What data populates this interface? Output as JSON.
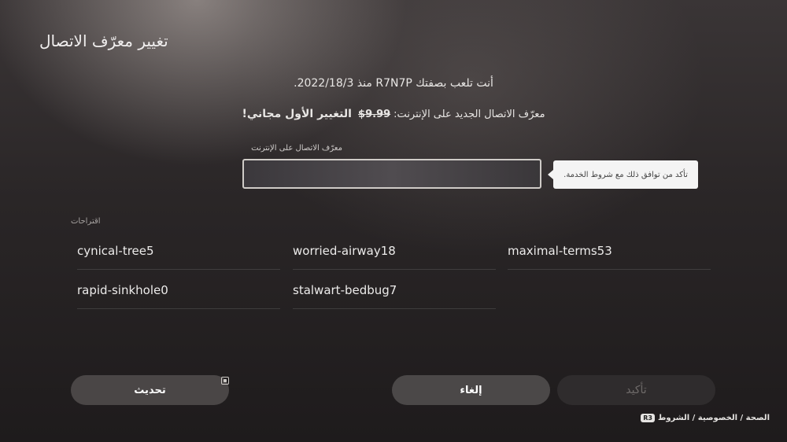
{
  "header": {
    "title": "تغيير معرّف الاتصال"
  },
  "info": {
    "line1": "أنت تلعب بصفتك R7N7P منذ 2022/18/3.",
    "line2_prefix": "معرّف الاتصال الجديد على الإنترنت:",
    "line2_price": "9.99$",
    "line2_free": "التغيير الأول مجاني!"
  },
  "field": {
    "label": "معرّف الاتصال على الإنترنت",
    "value": "",
    "placeholder": ""
  },
  "tooltip": {
    "text": "تأكد من توافق ذلك مع شروط الخدمة."
  },
  "suggestions": {
    "label": "اقتراحات",
    "items": [
      "cynical-tree5",
      "worried-airway18",
      "maximal-terms53",
      "rapid-sinkhole0",
      "stalwart-bedbug7"
    ]
  },
  "buttons": {
    "refresh": "تحديث",
    "cancel": "إلغاء",
    "confirm": "تأكيد"
  },
  "footer": {
    "text": "الصحة / الخصوصية / الشروط",
    "badge": "R3"
  },
  "icons": {
    "refresh_button_glyph": "touchpad-icon"
  }
}
